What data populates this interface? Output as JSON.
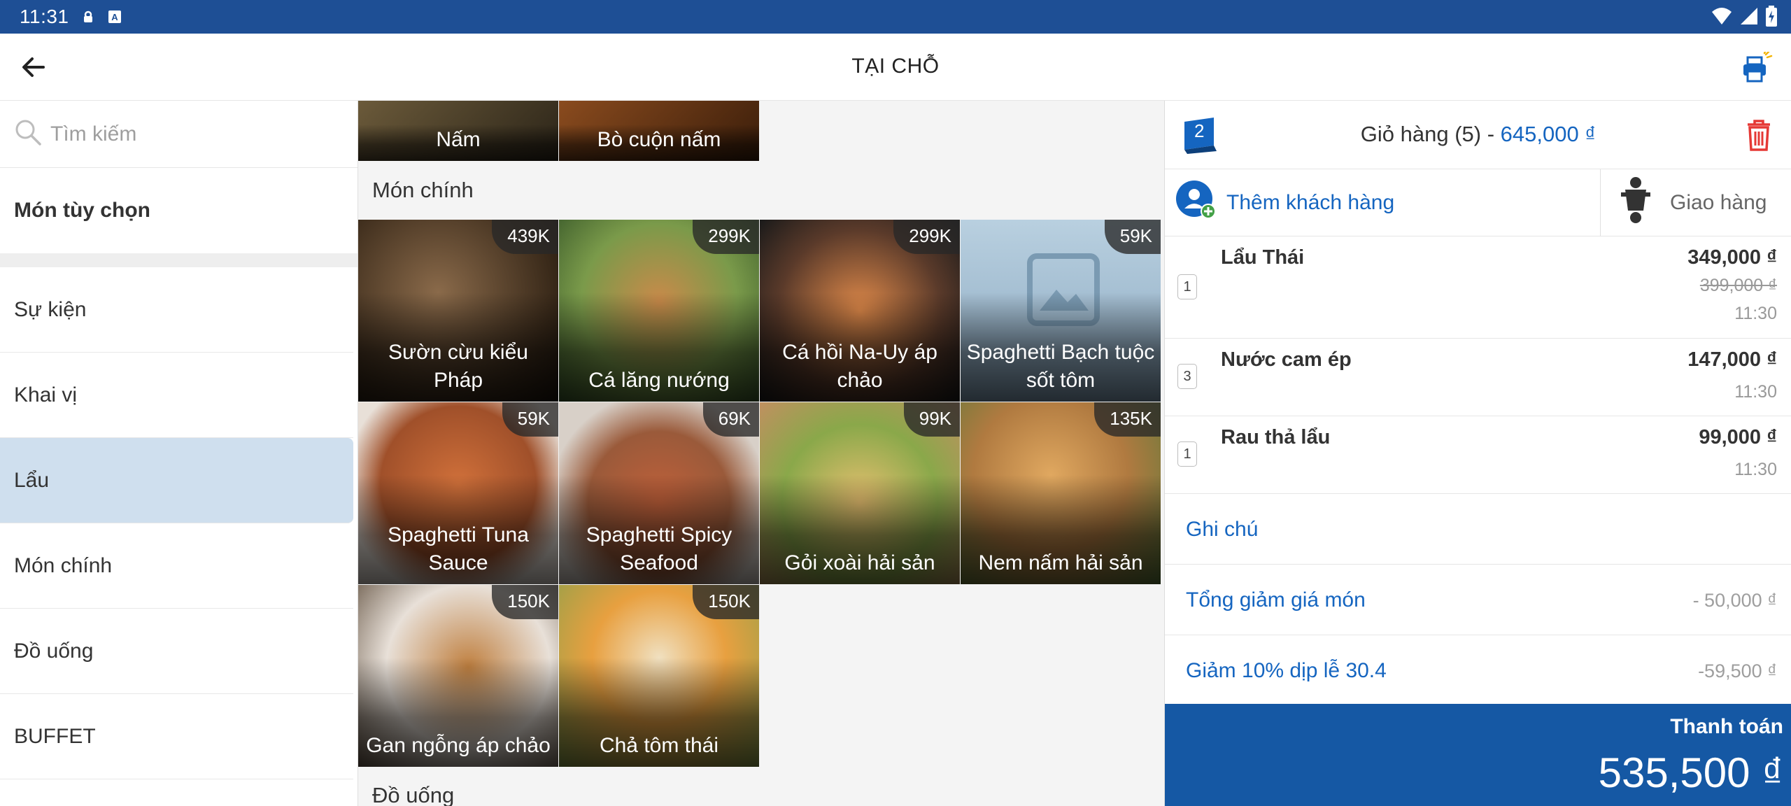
{
  "status_bar": {
    "time": "11:31",
    "icons": [
      "vpn-key-icon",
      "text-a-icon",
      "wifi-icon",
      "cell-signal-icon",
      "battery-charging-icon"
    ]
  },
  "appbar": {
    "title": "TẠI CHỖ",
    "back_icon": "arrow-back-icon",
    "printer_icon": "printer-icon"
  },
  "sidebar": {
    "search_placeholder": "Tìm kiếm",
    "custom_item": "Món tùy chọn",
    "categories": [
      {
        "label": "Sự kiện",
        "active": false
      },
      {
        "label": "Khai vị",
        "active": false
      },
      {
        "label": "Lẩu",
        "active": true
      },
      {
        "label": "Món chính",
        "active": false
      },
      {
        "label": "Đồ uống",
        "active": false
      },
      {
        "label": "BUFFET",
        "active": false
      }
    ]
  },
  "menu": {
    "top_partial": [
      {
        "name": "Nấm"
      },
      {
        "name": "Bò cuộn nấm"
      }
    ],
    "section_main": "Món chính",
    "section_drinks": "Đồ uống",
    "items": [
      {
        "name": "Sườn cừu kiểu Pháp",
        "price": "439K"
      },
      {
        "name": "Cá lăng nướng",
        "price": "299K"
      },
      {
        "name": "Cá hồi Na-Uy áp chảo",
        "price": "299K"
      },
      {
        "name": "Spaghetti Bạch tuộc sốt tôm",
        "price": "59K"
      },
      {
        "name": "Spaghetti Tuna Sauce",
        "price": "59K"
      },
      {
        "name": "Spaghetti Spicy Seafood",
        "price": "69K"
      },
      {
        "name": "Gỏi xoài hải sản",
        "price": "99K"
      },
      {
        "name": "Nem nấm hải sản",
        "price": "135K"
      },
      {
        "name": "Gan ngỗng áp chảo",
        "price": "150K"
      },
      {
        "name": "Chả tôm thái",
        "price": "150K"
      }
    ]
  },
  "cart": {
    "table_number": "2",
    "title": "Giỏ hàng (5) - ",
    "total": "645,000 ₫",
    "add_customer": "Thêm khách hàng",
    "delivery": "Giao hàng",
    "lines": [
      {
        "qty": "1",
        "name": "Lẩu Thái",
        "price": "349,000 ₫",
        "old_price": "399,000 ₫",
        "time": "11:30"
      },
      {
        "qty": "3",
        "name": "Nước cam ép",
        "price": "147,000 ₫",
        "time": "11:30"
      },
      {
        "qty": "1",
        "name": "Rau thả lẩu",
        "price": "99,000 ₫",
        "time": "11:30"
      }
    ],
    "note_label": "Ghi chú",
    "discounts": [
      {
        "label": "Tổng giảm giá món",
        "value": "- 50,000 ₫"
      },
      {
        "label": "Giảm 10% dịp lễ 30.4",
        "value": "-59,500 ₫"
      }
    ],
    "pay_label": "Thanh toán",
    "pay_amount": "535,500 ₫"
  },
  "colors": {
    "status_bar": "#1e4f95",
    "accent": "#1565c0",
    "pay_button": "#1558a4",
    "active_category": "#cfdfee",
    "trash": "#e53935"
  }
}
